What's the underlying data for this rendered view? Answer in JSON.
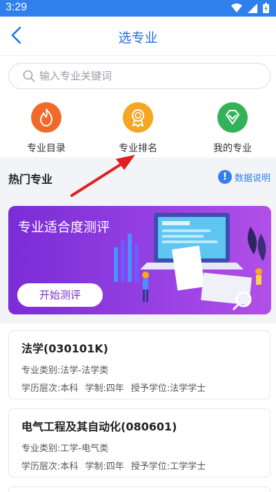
{
  "status_bar": {
    "time": "3:29"
  },
  "nav": {
    "title": "选专业"
  },
  "search": {
    "placeholder": "输入专业关键词"
  },
  "quick_actions": [
    {
      "label": "专业目录",
      "icon": "flame-icon",
      "color": "#f06a2a"
    },
    {
      "label": "专业排名",
      "icon": "medal-icon",
      "color": "#f5a623"
    },
    {
      "label": "我的专业",
      "icon": "heart-diamond-icon",
      "color": "#34b25a"
    }
  ],
  "hot_section": {
    "title": "热门专业",
    "info_label": "数据说明"
  },
  "banner": {
    "title": "专业适合度测评",
    "button": "开始测评"
  },
  "majors": [
    {
      "name": "法学(030101K)",
      "category": "专业类别:法学-法学类",
      "level": "学历层次:本科",
      "duration": "学制:四年",
      "degree": "授予学位:法学学士"
    },
    {
      "name": "电气工程及其自动化(080601)",
      "category": "专业类别:工学-电气类",
      "level": "学历层次:本科",
      "duration": "学制:四年",
      "degree": "授予学位:工学学士"
    }
  ],
  "colors": {
    "primary": "#2f80ed",
    "title_blue": "#1f6fe0",
    "annotation_red": "#e02020"
  }
}
